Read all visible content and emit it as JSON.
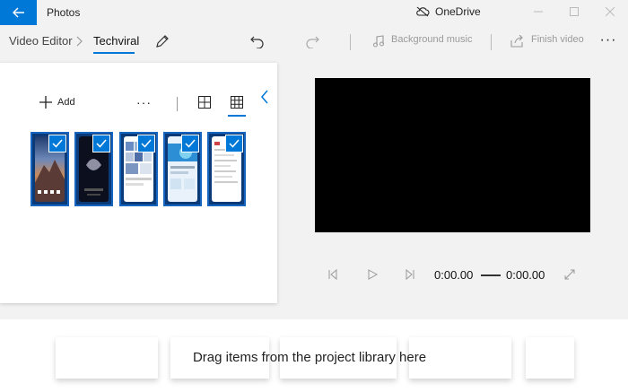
{
  "window": {
    "app_title": "Photos",
    "onedrive_label": "OneDrive"
  },
  "toolbar": {
    "breadcrumb_root": "Video Editor",
    "project_name": "Techviral",
    "background_music_label": "Background music",
    "finish_video_label": "Finish video"
  },
  "library": {
    "add_label": "Add",
    "more_label": "···",
    "thumbnails": [
      {
        "name": "mac-wallpaper-screenshot",
        "selected": true
      },
      {
        "name": "dark-phone-screenshot",
        "selected": true
      },
      {
        "name": "gallery-grid-screenshot",
        "selected": true
      },
      {
        "name": "blue-app-screenshot",
        "selected": true
      },
      {
        "name": "settings-list-screenshot",
        "selected": true
      }
    ]
  },
  "player": {
    "current_time": "0:00.00",
    "total_time": "0:00.00"
  },
  "storyboard": {
    "placeholder": "Drag items from the project library here"
  },
  "colors": {
    "accent": "#0078d7",
    "preview_bg": "#000000"
  }
}
